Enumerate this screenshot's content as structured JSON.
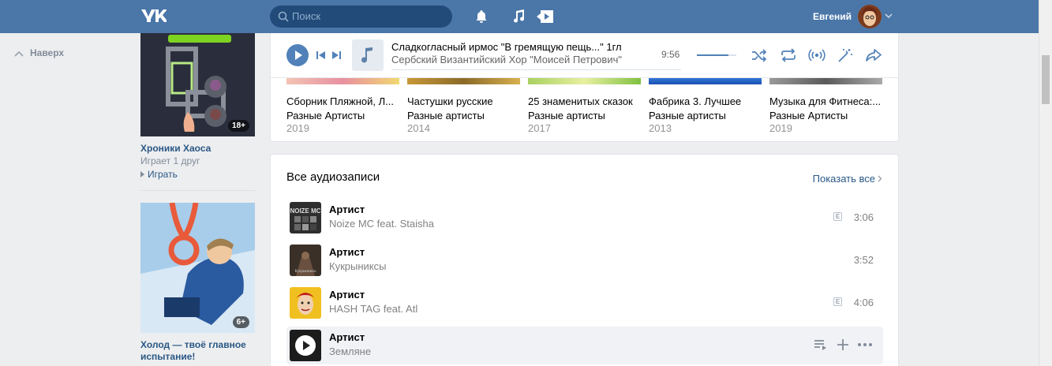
{
  "header": {
    "logo": "vk-logo-icon",
    "search_placeholder": "Поиск",
    "user_name": "Евгений"
  },
  "sidebar": {
    "back_to_top": "Наверх"
  },
  "games": [
    {
      "title": "Хроники Хаоса",
      "subtitle": "Играет 1 друг",
      "action": "Играть",
      "age": "18+"
    },
    {
      "title": "Холод — твоё главное испытание!",
      "age": "6+"
    }
  ],
  "player": {
    "track_title": "Сладкогласный ирмос \"В гремящую пещь...\" 1гл",
    "track_artist": "Сербский Византийский Хор \"Моисей Петрович\"",
    "time": "9:56",
    "volume_level": 0.8,
    "controls": [
      "shuffle-icon",
      "repeat-icon",
      "broadcast-icon",
      "similar-icon",
      "share-icon"
    ]
  },
  "albums": [
    {
      "title": "Сборник Пляжной, Л...",
      "artist": "Разные Артисты",
      "year": "2019",
      "color": "#e8b4b0"
    },
    {
      "title": "Частушки русские",
      "artist": "Разные артисты",
      "year": "2014",
      "color": "#b89040"
    },
    {
      "title": "25 знаменитых сказок",
      "artist": "Разные артисты",
      "year": "2017",
      "color": "#9cc85a"
    },
    {
      "title": "Фабрика 3. Лучшее",
      "artist": "Разные артисты",
      "year": "2013",
      "color": "#2a6fd0"
    },
    {
      "title": "Музыка для Фитнеса:...",
      "artist": "Разные Артисты",
      "year": "2019",
      "color": "#8a8a8a"
    }
  ],
  "audio_section": {
    "title": "Все аудиозаписи",
    "show_all": "Показать все",
    "tracks": [
      {
        "title": "Артист",
        "artist": "Noize MC feat. Staisha",
        "duration": "3:06",
        "explicit": true,
        "thumb_color": "#3a3a3a"
      },
      {
        "title": "Артист",
        "artist": "Кукрыниксы",
        "duration": "3:52",
        "explicit": false,
        "thumb_color": "#5a4a3a"
      },
      {
        "title": "Артист",
        "artist": "HASH TAG feat. Atl",
        "duration": "4:06",
        "explicit": true,
        "thumb_color": "#e8c020"
      },
      {
        "title": "Артист",
        "artist": "Земляне",
        "duration": "",
        "explicit": false,
        "thumb_color": "#1c1c1c",
        "active": true
      }
    ],
    "explicit_label": "E"
  }
}
